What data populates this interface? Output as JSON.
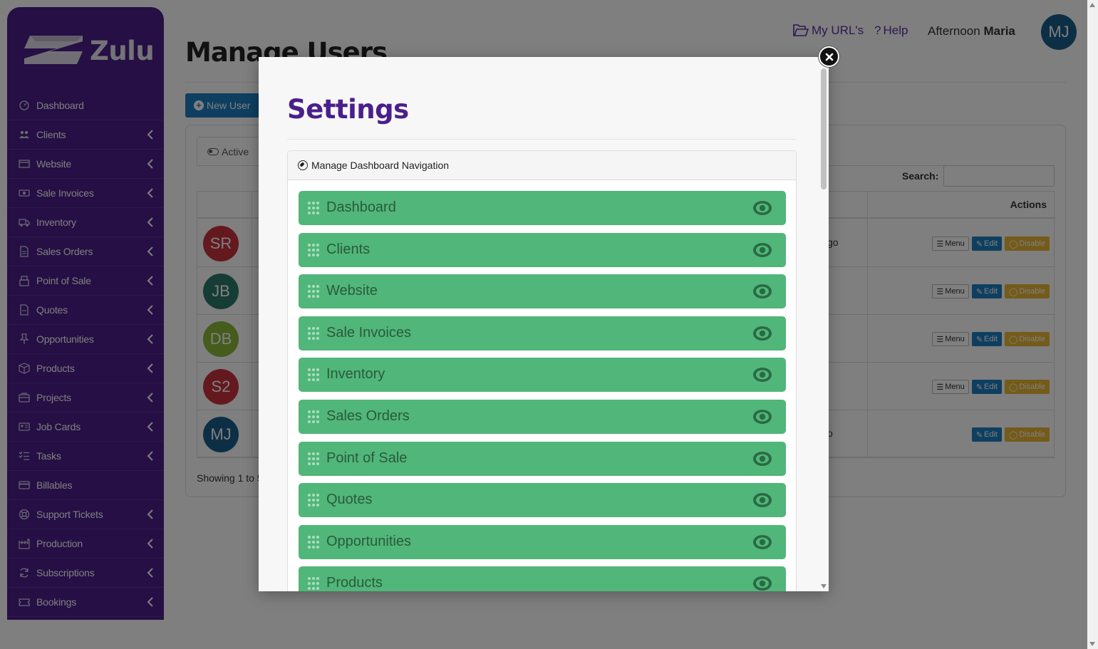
{
  "app": {
    "logo_text": "Zulu",
    "page_title": "Manage Users"
  },
  "header": {
    "my_urls": "My URL's",
    "help": "Help",
    "greeting": "Afternoon",
    "user_name": "Maria",
    "avatar_initials": "MJ"
  },
  "sidebar": {
    "items": [
      {
        "label": "Dashboard",
        "icon": "dashboard-icon",
        "has_chevron": false
      },
      {
        "label": "Clients",
        "icon": "users-icon",
        "has_chevron": true
      },
      {
        "label": "Website",
        "icon": "window-icon",
        "has_chevron": true
      },
      {
        "label": "Sale Invoices",
        "icon": "money-icon",
        "has_chevron": true
      },
      {
        "label": "Inventory",
        "icon": "truck-icon",
        "has_chevron": true
      },
      {
        "label": "Sales Orders",
        "icon": "file-icon",
        "has_chevron": true
      },
      {
        "label": "Point of Sale",
        "icon": "register-icon",
        "has_chevron": true
      },
      {
        "label": "Quotes",
        "icon": "document-icon",
        "has_chevron": true
      },
      {
        "label": "Opportunities",
        "icon": "pin-icon",
        "has_chevron": true
      },
      {
        "label": "Products",
        "icon": "box-icon",
        "has_chevron": true
      },
      {
        "label": "Projects",
        "icon": "briefcase-icon",
        "has_chevron": true
      },
      {
        "label": "Job Cards",
        "icon": "id-card-icon",
        "has_chevron": true
      },
      {
        "label": "Tasks",
        "icon": "list-icon",
        "has_chevron": true
      },
      {
        "label": "Billables",
        "icon": "credit-card-icon",
        "has_chevron": false
      },
      {
        "label": "Support Tickets",
        "icon": "lifebuoy-icon",
        "has_chevron": true
      },
      {
        "label": "Production",
        "icon": "factory-icon",
        "has_chevron": true
      },
      {
        "label": "Subscriptions",
        "icon": "refresh-icon",
        "has_chevron": true
      },
      {
        "label": "Bookings",
        "icon": "ticket-icon",
        "has_chevron": true
      }
    ]
  },
  "background": {
    "new_user_label": "New User",
    "active_tab_label": "Active",
    "search_label": "Search:",
    "actions_header": "Actions",
    "showing_text": "Showing 1 to 5",
    "rows": [
      {
        "initials": "SR",
        "color": "#c9323f",
        "fragment": "go",
        "menu": "Menu",
        "edit": "Edit",
        "disable": "Disable",
        "has_menu": true
      },
      {
        "initials": "JB",
        "color": "#2c7a6b",
        "fragment": "",
        "menu": "Menu",
        "edit": "Edit",
        "disable": "Disable",
        "has_menu": true
      },
      {
        "initials": "DB",
        "color": "#8ab93a",
        "fragment": "",
        "menu": "Menu",
        "edit": "Edit",
        "disable": "Disable",
        "has_menu": true
      },
      {
        "initials": "S2",
        "color": "#c9323f",
        "fragment": "",
        "menu": "Menu",
        "edit": "Edit",
        "disable": "Disable",
        "has_menu": true
      },
      {
        "initials": "MJ",
        "color": "#1b5e8a",
        "fragment": "o",
        "menu": "",
        "edit": "Edit",
        "disable": "Disable",
        "has_menu": false
      }
    ]
  },
  "modal": {
    "title": "Settings",
    "panel_title": "Manage Dashboard Navigation",
    "items": [
      {
        "label": "Dashboard"
      },
      {
        "label": "Clients"
      },
      {
        "label": "Website"
      },
      {
        "label": "Sale Invoices"
      },
      {
        "label": "Inventory"
      },
      {
        "label": "Sales Orders"
      },
      {
        "label": "Point of Sale"
      },
      {
        "label": "Quotes"
      },
      {
        "label": "Opportunities"
      },
      {
        "label": "Products"
      }
    ]
  },
  "colors": {
    "sidebar_bg": "#4a1f8a",
    "accent_purple": "#4a1f8a",
    "item_green": "#51b679",
    "primary_blue": "#1e7fc1",
    "warning_yellow": "#e8b634"
  }
}
